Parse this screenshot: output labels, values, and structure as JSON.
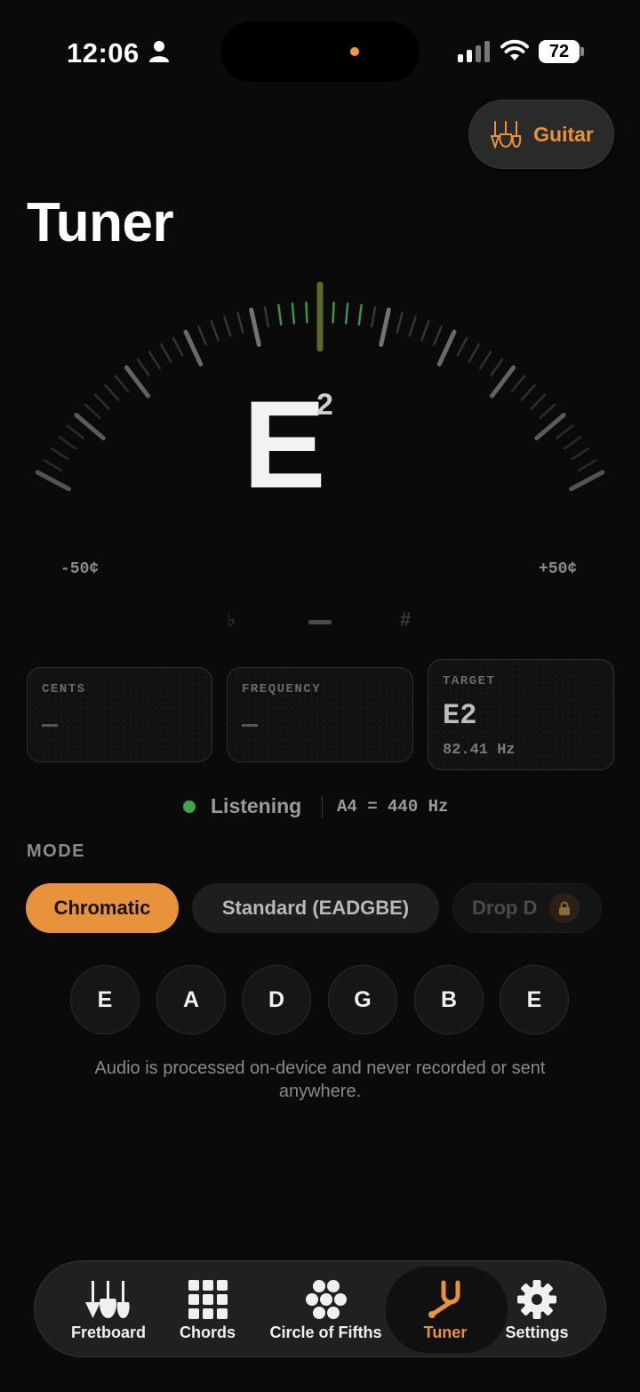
{
  "status_bar": {
    "time": "12:06",
    "battery": "72"
  },
  "header": {
    "instrument_label": "Guitar",
    "title": "Tuner"
  },
  "tuner": {
    "note": "E",
    "octave": "2",
    "cents_min_label": "-50¢",
    "cents_max_label": "+50¢",
    "flat_symbol": "♭",
    "sharp_symbol": "#"
  },
  "cards": {
    "cents": {
      "label": "CENTS",
      "value": "—"
    },
    "frequency": {
      "label": "FREQUENCY",
      "value": "—"
    },
    "target": {
      "label": "TARGET",
      "value": "E2",
      "sub": "82.41 Hz"
    }
  },
  "status": {
    "listening": "Listening",
    "reference": "A4 = 440 Hz"
  },
  "mode": {
    "label": "MODE",
    "options": [
      {
        "label": "Chromatic",
        "selected": true
      },
      {
        "label": "Standard (EADGBE)",
        "selected": false
      },
      {
        "label": "Drop D",
        "locked": true
      }
    ]
  },
  "strings": [
    "E",
    "A",
    "D",
    "G",
    "B",
    "E"
  ],
  "privacy_note": "Audio is processed on-device and never recorded or sent anywhere.",
  "tabs": [
    {
      "label": "Fretboard",
      "icon": "guitars-icon"
    },
    {
      "label": "Chords",
      "icon": "grid-icon"
    },
    {
      "label": "Circle of Fifths",
      "icon": "circle-cluster-icon"
    },
    {
      "label": "Tuner",
      "icon": "tuning-fork-icon",
      "active": true
    },
    {
      "label": "Settings",
      "icon": "gear-icon"
    }
  ],
  "colors": {
    "accent": "#e8923b",
    "in_tune": "#3fa650",
    "background": "#0a0a0a"
  }
}
